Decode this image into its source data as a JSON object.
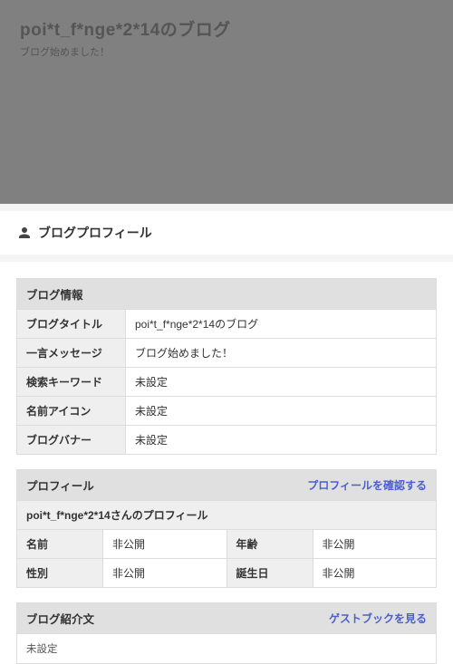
{
  "hero": {
    "title": "poi*t_f*nge*2*14のブログ",
    "subtitle": "ブログ始めました！"
  },
  "section_bar": {
    "label": "ブログプロフィール"
  },
  "blog_info": {
    "heading": "ブログ情報",
    "rows": {
      "title_label": "ブログタイトル",
      "title_value": "poi*t_f*nge*2*14のブログ",
      "msg_label": "一言メッセージ",
      "msg_value": "ブログ始めました！",
      "keyword_label": "検索キーワード",
      "keyword_value": "未設定",
      "icon_label": "名前アイコン",
      "icon_value": "未設定",
      "banner_label": "ブログバナー",
      "banner_value": "未設定"
    }
  },
  "profile": {
    "heading": "プロフィール",
    "heading_link": "プロフィールを確認する",
    "subheading": "poi*t_f*nge*2*14さんのプロフィール",
    "rows": {
      "name_label": "名前",
      "name_value": "非公開",
      "age_label": "年齢",
      "age_value": "非公開",
      "gender_label": "性別",
      "gender_value": "非公開",
      "bday_label": "誕生日",
      "bday_value": "非公開"
    }
  },
  "intro": {
    "heading": "ブログ紹介文",
    "heading_link": "ゲストブックを見る",
    "body": "未設定"
  }
}
